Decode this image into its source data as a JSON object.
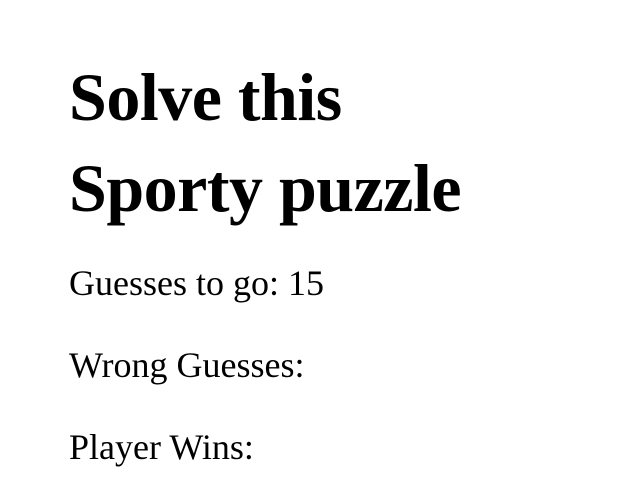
{
  "game": {
    "title_line1": "Solve this",
    "title_line2": "Sporty puzzle",
    "guesses_label": "Guesses to go: ",
    "guesses_value": "15",
    "wrong_label": "Wrong Guesses:",
    "wrong_value": "",
    "wins_label": "Player Wins:",
    "wins_value": ""
  }
}
